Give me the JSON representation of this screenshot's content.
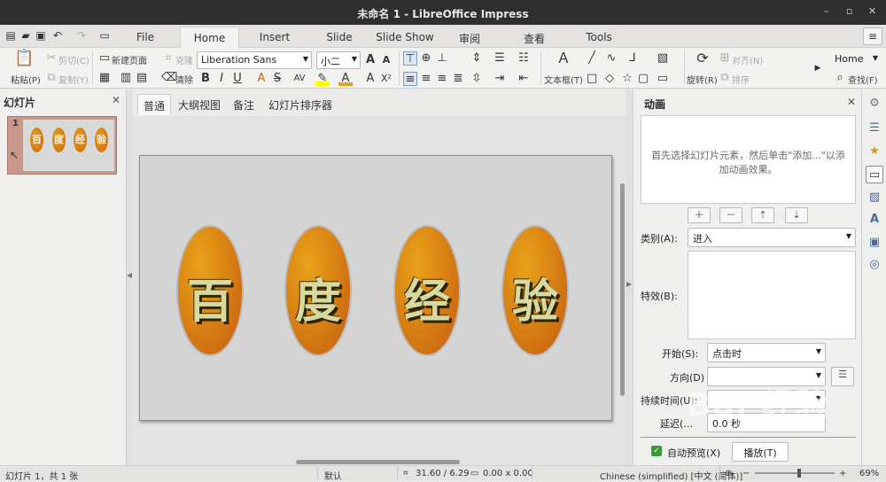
{
  "window": {
    "title": "未命名 1 - LibreOffice Impress",
    "minimize": "–",
    "restore": "▫",
    "close": "✕"
  },
  "menu": {
    "tabs": [
      {
        "label": "File"
      },
      {
        "label": "Home"
      },
      {
        "label": "Insert"
      },
      {
        "label": "Slide"
      },
      {
        "label": "Slide Show"
      },
      {
        "label": "审阅"
      },
      {
        "label": "查看"
      },
      {
        "label": "Tools"
      }
    ],
    "active_tab": "Home"
  },
  "ribbon": {
    "paste": "粘贴(P)",
    "cut": "剪切(C)",
    "copy": "复制(Y)",
    "new_page": "新建页面",
    "clone": "克隆",
    "clear": "清除",
    "font_name": "Liberation Sans",
    "font_size": "小二",
    "textbox": "文本框(T)",
    "rotate": "旋转(R)",
    "align": "对齐(N)",
    "arrange": "排序",
    "home_combo": "Home",
    "find": "查找(F)"
  },
  "slides_panel": {
    "title": "幻灯片",
    "slide_number": "1",
    "thumb_chars": [
      "百",
      "度",
      "经",
      "验"
    ]
  },
  "view_tabs": [
    {
      "label": "普通"
    },
    {
      "label": "大纲视图"
    },
    {
      "label": "备注"
    },
    {
      "label": "幻灯片排序器"
    }
  ],
  "slide": {
    "chars": [
      "百",
      "度",
      "经",
      "验"
    ],
    "oval_color": "#d98413",
    "text_color": "#d8d9a0"
  },
  "animation": {
    "title": "动画",
    "empty_hint": "首先选择幻灯片元素，然后单击\"添加...\"以添加动画效果。",
    "category_label": "类别(A):",
    "category_value": "进入",
    "effect_label": "特效(B):",
    "start_label": "开始(S):",
    "start_value": "点击时",
    "direction_label": "方向(D)",
    "direction_value": "",
    "duration_label": "持续时间(U):",
    "duration_value": "",
    "delay_label": "延迟(…",
    "delay_value": "0.0 秒",
    "autopreview_label": "自动预览(X)",
    "play_button": "播放(T)"
  },
  "status": {
    "slide_of": "幻灯片 1，共 1 张",
    "layout": "默认",
    "position": "31.60 / 6.29",
    "size": "0.00 x 0.00",
    "language": "Chinese (simplified) [中文 (简体)]",
    "zoom": "69%"
  },
  "watermark": "Bai 经验"
}
